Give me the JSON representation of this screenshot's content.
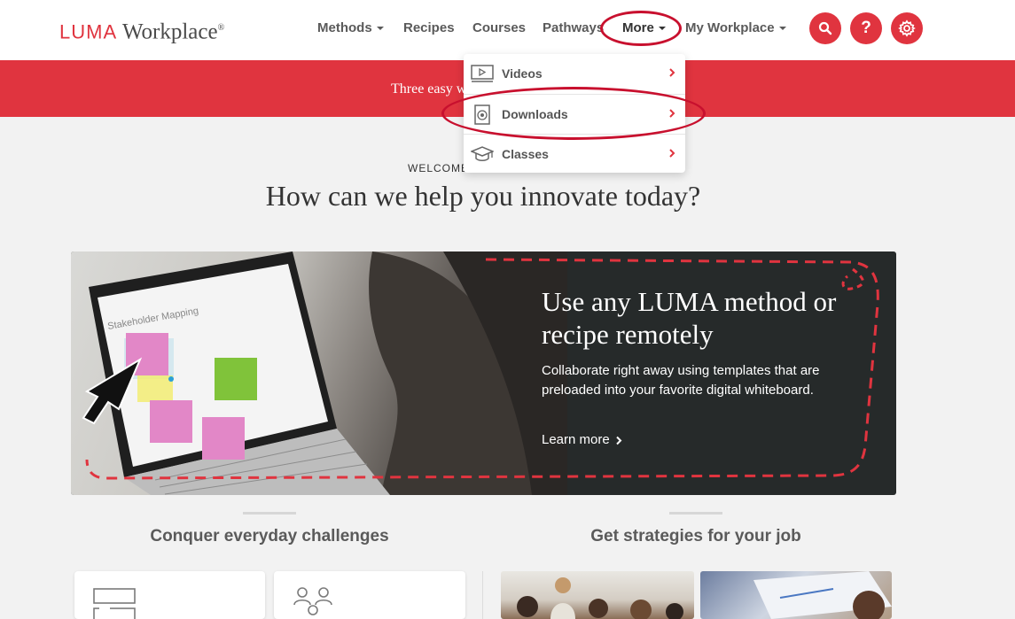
{
  "header": {
    "logo_brand": "LUMA",
    "logo_product": "Workplace",
    "logo_reg": "®",
    "nav": {
      "methods": "Methods",
      "recipes": "Recipes",
      "courses": "Courses",
      "pathways": "Pathways",
      "more": "More",
      "my_workplace": "My Workplace"
    },
    "help_label": "?",
    "icons": [
      "search-icon",
      "help-icon",
      "gear-icon"
    ]
  },
  "banner": {
    "text": "Three easy w"
  },
  "dropdown": {
    "items": [
      {
        "label": "Videos",
        "icon": "video-icon"
      },
      {
        "label": "Downloads",
        "icon": "download-icon"
      },
      {
        "label": "Classes",
        "icon": "graduation-cap-icon"
      }
    ]
  },
  "welcome": {
    "eyebrow": "WELCOME",
    "headline": "How can we help you innovate today?"
  },
  "hero": {
    "title": "Use any LUMA method or recipe remotely",
    "description": "Collaborate right away using templates that are preloaded into your favorite digital whiteboard.",
    "link": "Learn more",
    "screen_text": "Stakeholder Mapping"
  },
  "sections": {
    "left_title": "Conquer everyday challenges",
    "right_title": "Get strategies for your job"
  },
  "colors": {
    "brand_red": "#e0343f",
    "annotation": "#c8102e",
    "hero_bg": "#262a2a"
  }
}
